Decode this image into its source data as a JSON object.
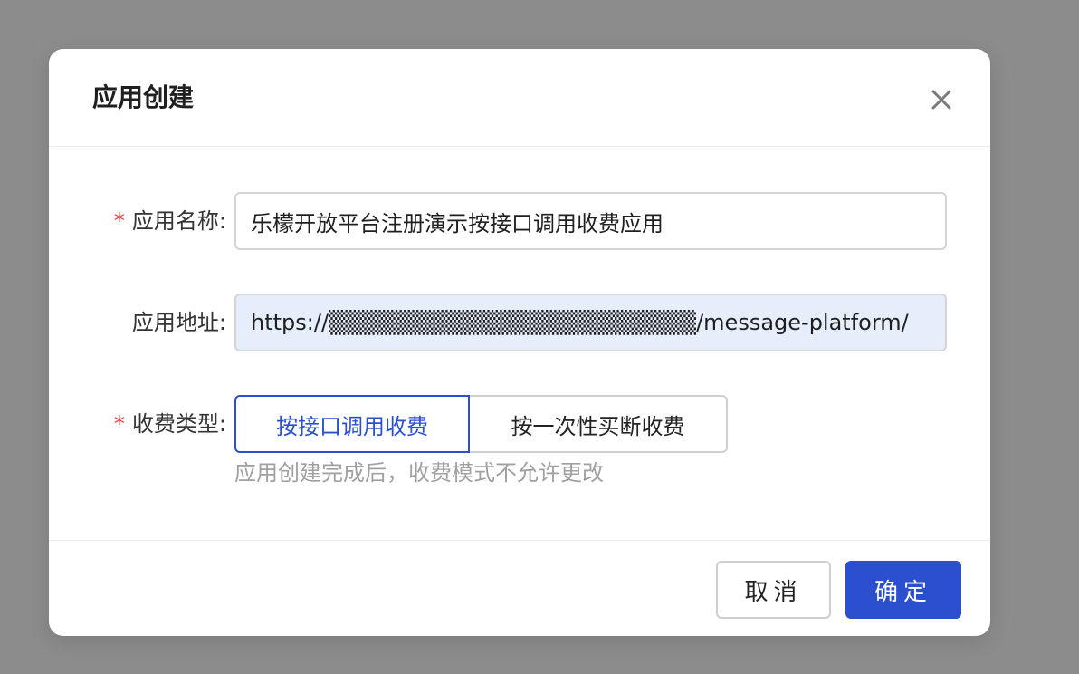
{
  "dialog": {
    "title": "应用创建",
    "close_icon": "close-icon"
  },
  "form": {
    "app_name": {
      "required": "*",
      "label": "应用名称:",
      "value": "乐檬开放平台注册演示按接口调用收费应用"
    },
    "app_url": {
      "label": "应用地址:",
      "value": "https://▒▒▒▒▒▒▒▒▒▒▒▒▒▒▒▒▒▒▒▒▒▒/message-platform/"
    },
    "billing_type": {
      "required": "*",
      "label": "收费类型:",
      "options": [
        {
          "label": "按接口调用收费",
          "selected": true
        },
        {
          "label": "按一次性买断收费",
          "selected": false
        }
      ],
      "hint": "应用创建完成后，收费模式不允许更改"
    }
  },
  "footer": {
    "cancel_label": "取消",
    "ok_label": "确定"
  },
  "colors": {
    "primary": "#2b4fce",
    "required": "#e5484d",
    "overlay": "#8c8c8c",
    "autofill_bg": "#e6eefc"
  }
}
